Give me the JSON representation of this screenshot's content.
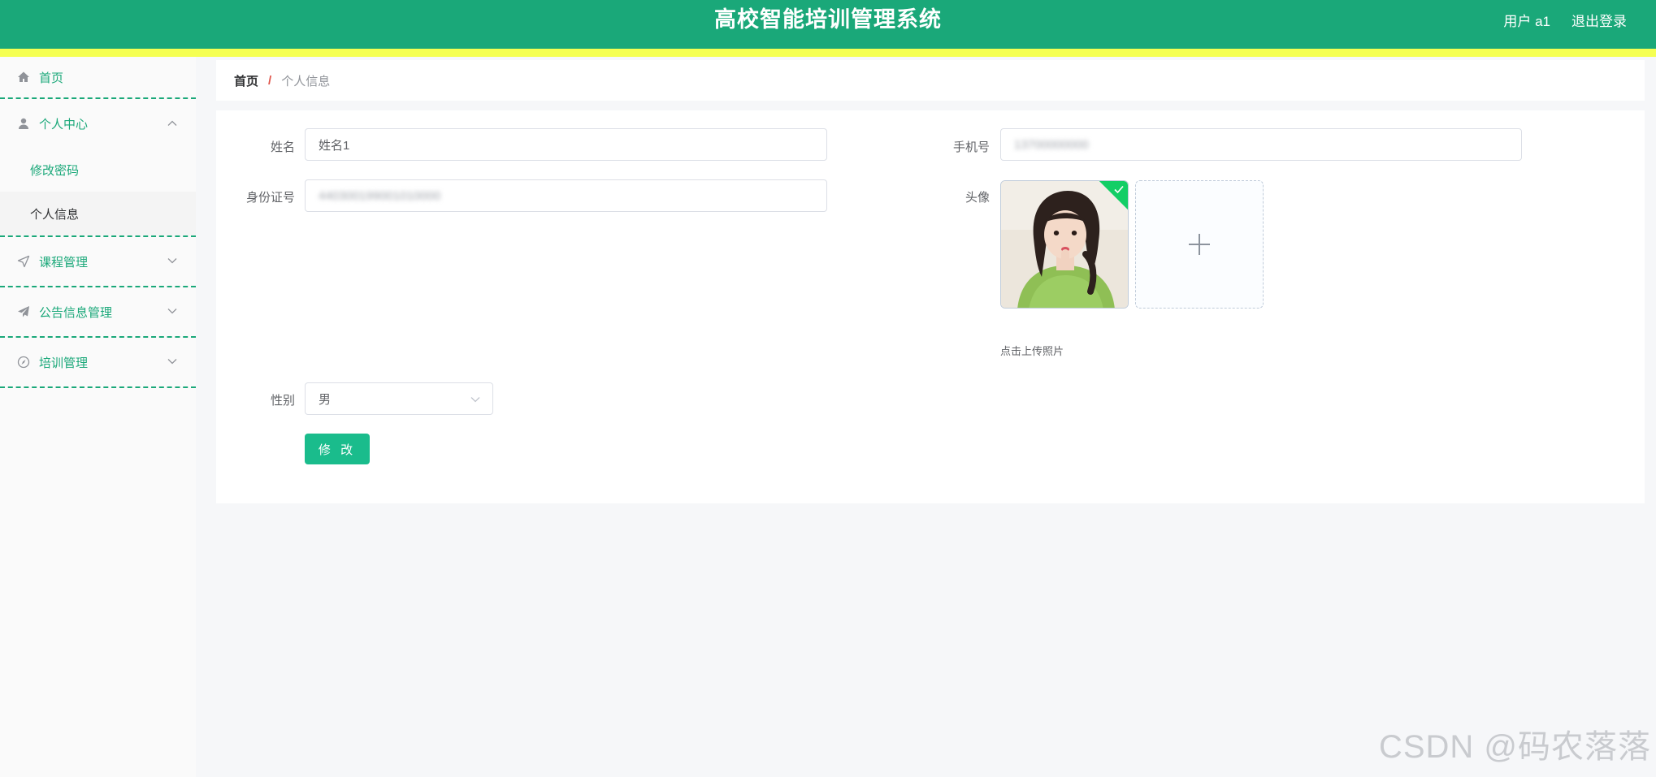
{
  "header": {
    "title": "高校智能培训管理系统",
    "user_label": "用户 a1",
    "logout_label": "退出登录",
    "colors": {
      "bar": "#1aa879",
      "stripe": "#f5ff52"
    }
  },
  "sidebar": {
    "items": [
      {
        "label": "首页",
        "icon": "home-icon"
      },
      {
        "label": "个人中心",
        "icon": "user-icon",
        "expanded": true,
        "children": [
          {
            "label": "修改密码"
          },
          {
            "label": "个人信息",
            "active": true
          }
        ]
      },
      {
        "label": "课程管理",
        "icon": "navigation-icon"
      },
      {
        "label": "公告信息管理",
        "icon": "send-icon"
      },
      {
        "label": "培训管理",
        "icon": "compass-icon"
      }
    ]
  },
  "breadcrumb": {
    "home": "首页",
    "separator": "/",
    "current": "个人信息"
  },
  "form": {
    "name": {
      "label": "姓名",
      "value": "姓名1"
    },
    "phone": {
      "label": "手机号",
      "value": "13700000000"
    },
    "id_card": {
      "label": "身份证号",
      "value": "440300199001010000"
    },
    "avatar": {
      "label": "头像",
      "tip": "点击上传照片",
      "uploaded": true
    },
    "gender": {
      "label": "性别",
      "value": "男"
    },
    "submit_label": "修 改"
  },
  "watermark": "CSDN @码农落落"
}
